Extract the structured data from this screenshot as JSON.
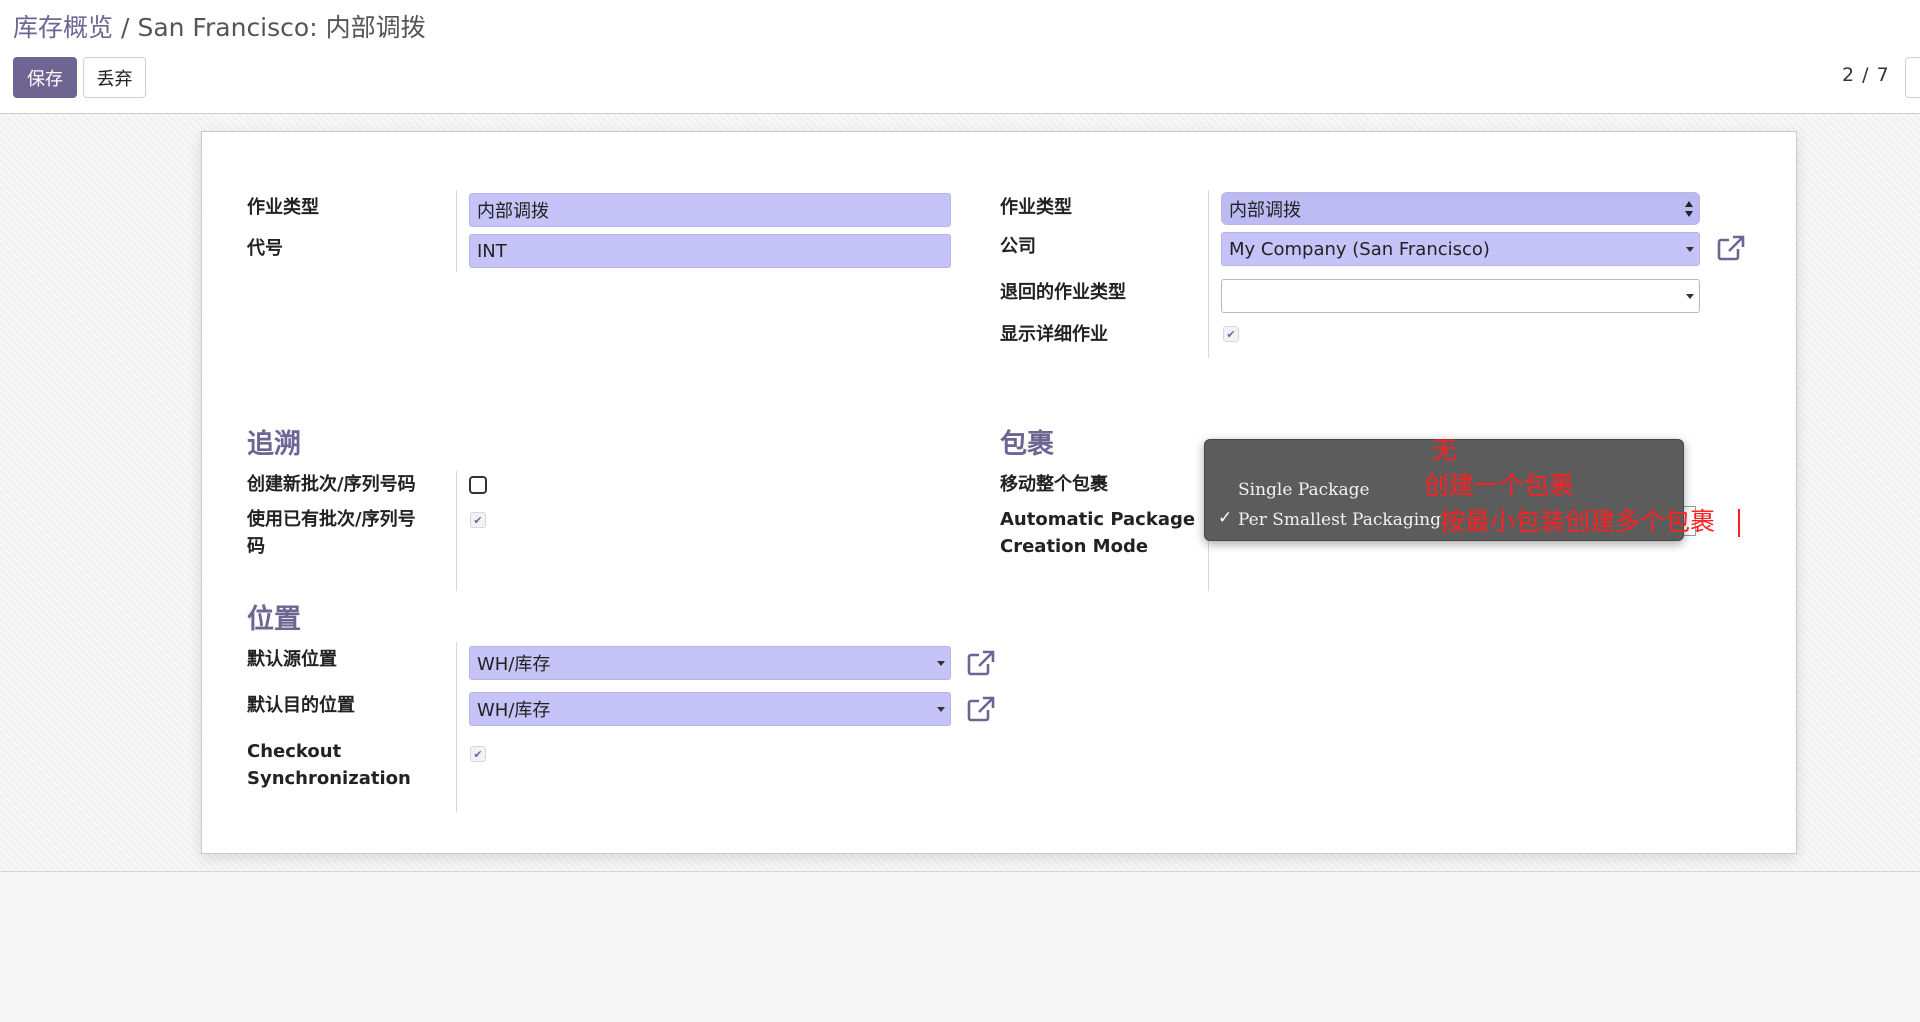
{
  "breadcrumb": {
    "root": "库存概览",
    "separator": "/",
    "current": "San Francisco: 内部调拨"
  },
  "toolbar": {
    "save_label": "保存",
    "discard_label": "丢弃"
  },
  "pager": {
    "text": "2 / 7"
  },
  "form": {
    "left": {
      "operation_type_label": "作业类型",
      "operation_type_value": "内部调拨",
      "code_label": "代号",
      "code_value": "INT"
    },
    "right": {
      "operation_type_label": "作业类型",
      "operation_type_value": "内部调拨",
      "company_label": "公司",
      "company_value": "My Company (San Francisco)",
      "return_type_label": "退回的作业类型",
      "return_type_value": "",
      "show_detailed_label": "显示详细作业",
      "show_detailed_checked": true
    },
    "traceability": {
      "title": "追溯",
      "create_lots_label": "创建新批次/序列号码",
      "create_lots_checked": false,
      "use_existing_lots_label_line1": "使用已有批次/序列号",
      "use_existing_lots_label_line2": "码",
      "use_existing_lots_checked": true
    },
    "packages": {
      "title": "包裹",
      "move_entire_label": "移动整个包裹",
      "auto_mode_label_line1": "Automatic Package",
      "auto_mode_label_line2": "Creation Mode"
    },
    "locations": {
      "title": "位置",
      "default_src_label": "默认源位置",
      "default_src_value": "WH/库存",
      "default_dest_label": "默认目的位置",
      "default_dest_value": "WH/库存",
      "checkout_sync_label_line1": "Checkout",
      "checkout_sync_label_line2": "Synchronization",
      "checkout_sync_checked": true
    }
  },
  "dropdown": {
    "options": [
      "Single Package",
      "Per Smallest Packaging"
    ],
    "selected": "Per Smallest Packaging",
    "check_glyph": "✓"
  },
  "annotations": {
    "line1": "无",
    "line2": "创建一个包裹",
    "line3": "按最小包装创建多个包裹"
  },
  "colors": {
    "brand": "#6e6593",
    "input_bg": "#c5c3f7",
    "annotation": "#ff2020"
  }
}
